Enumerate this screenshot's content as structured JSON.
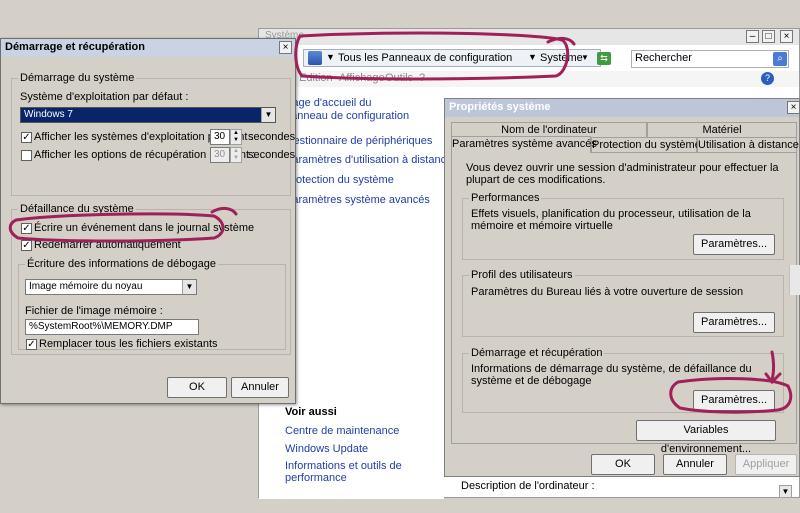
{
  "control_panel": {
    "title": "Système",
    "breadcrumb_root": "Tous les Panneaux de configuration",
    "breadcrumb_current": "Système",
    "search_placeholder": "Rechercher",
    "menu": [
      "Edition",
      "Affichage",
      "Outils",
      "?"
    ],
    "left_links": [
      "Page d'accueil du panneau de configuration",
      "Gestionnaire de périphériques",
      "Paramètres d'utilisation à distance",
      "Protection du système",
      "Paramètres système avancés"
    ],
    "see_also_title": "Voir aussi",
    "see_also_links": [
      "Centre de maintenance",
      "Windows Update",
      "Informations et outils de performance"
    ],
    "computer_description_label": "Description de l'ordinateur :"
  },
  "startup_dialog": {
    "title": "Démarrage et récupération",
    "close_glyph": "×",
    "system_startup_group": "Démarrage du système",
    "default_os_label": "Système d'exploitation par défaut :",
    "default_os_value": "Windows 7",
    "show_os_list_label": "Afficher les systèmes d'exploitation pendant :",
    "show_os_list_checked": true,
    "show_os_list_value": "30",
    "show_recovery_label": "Afficher les options de récupération pendant :",
    "show_recovery_checked": false,
    "show_recovery_value": "30",
    "seconds_label": "secondes",
    "system_failure_group": "Défaillance du système",
    "write_event_label": "Écrire un événement dans le journal système",
    "write_event_checked": true,
    "auto_restart_label": "Redémarrer automatiquement",
    "auto_restart_checked": true,
    "debug_info_group": "Écriture des informations de débogage",
    "debug_type_value": "Image mémoire du noyau",
    "dump_file_label": "Fichier de l'image mémoire :",
    "dump_file_value": "%SystemRoot%\\MEMORY.DMP",
    "overwrite_label": "Remplacer tous les fichiers existants",
    "overwrite_checked": true,
    "ok_label": "OK",
    "cancel_label": "Annuler"
  },
  "sysprops_dialog": {
    "title": "Propriétés système",
    "close_glyph": "×",
    "tabs_row1": [
      "Nom de l'ordinateur",
      "Matériel"
    ],
    "tabs_row2": [
      "Paramètres système avancés",
      "Protection du système",
      "Utilisation à distance"
    ],
    "admin_note": "Vous devez ouvrir une session d'administrateur pour effectuer la plupart de ces modifications.",
    "performance_group": "Performances",
    "performance_desc": "Effets visuels, planification du processeur, utilisation de la mémoire et mémoire virtuelle",
    "profiles_group": "Profil des utilisateurs",
    "profiles_desc": "Paramètres du Bureau liés à votre ouverture de session",
    "startup_group": "Démarrage et récupération",
    "startup_desc": "Informations de démarrage du système, de défaillance du système et de débogage",
    "settings_label": "Paramètres...",
    "env_vars_label": "Variables d'environnement...",
    "ok_label": "OK",
    "cancel_label": "Annuler",
    "apply_label": "Appliquer"
  },
  "colors": {
    "annotation": "#a0205a",
    "link": "#1e3fa6",
    "selected": "#0a246a"
  }
}
